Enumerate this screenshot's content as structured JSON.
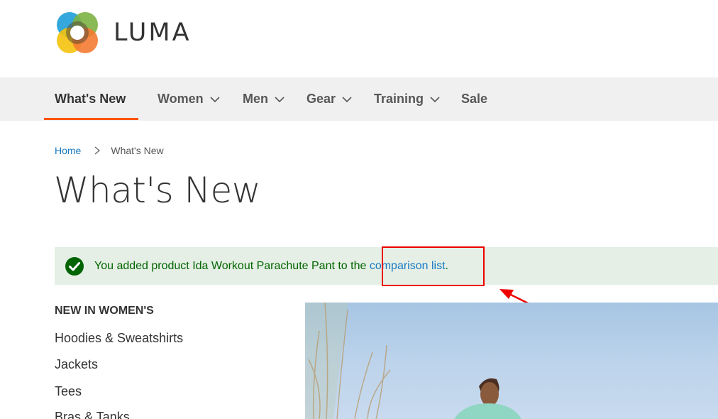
{
  "header": {
    "logo_text": "LUMA",
    "logo_colors": [
      "#f4b400",
      "#4caf50",
      "#1e88e5",
      "#ff7043"
    ]
  },
  "nav": {
    "items": [
      {
        "label": "What's New",
        "active": true,
        "has_dropdown": false
      },
      {
        "label": "Women",
        "active": false,
        "has_dropdown": true
      },
      {
        "label": "Men",
        "active": false,
        "has_dropdown": true
      },
      {
        "label": "Gear",
        "active": false,
        "has_dropdown": true
      },
      {
        "label": "Training",
        "active": false,
        "has_dropdown": true
      },
      {
        "label": "Sale",
        "active": false,
        "has_dropdown": false
      }
    ]
  },
  "breadcrumb": {
    "home": "Home",
    "current": "What's New"
  },
  "page_title": "What's New",
  "message": {
    "text_before": "You added product Ida Workout Parachute Pant to the ",
    "link_text": "comparison list",
    "text_after": ".",
    "status_color": "#006400",
    "background": "#e5efe5"
  },
  "sidebar": {
    "title": "NEW IN WOMEN'S",
    "items": [
      "Hoodies & Sweatshirts",
      "Jackets",
      "Tees",
      "Bras & Tanks"
    ]
  },
  "colors": {
    "accent": "#ff5501",
    "link": "#1979c3",
    "annotation": "#e00000"
  }
}
